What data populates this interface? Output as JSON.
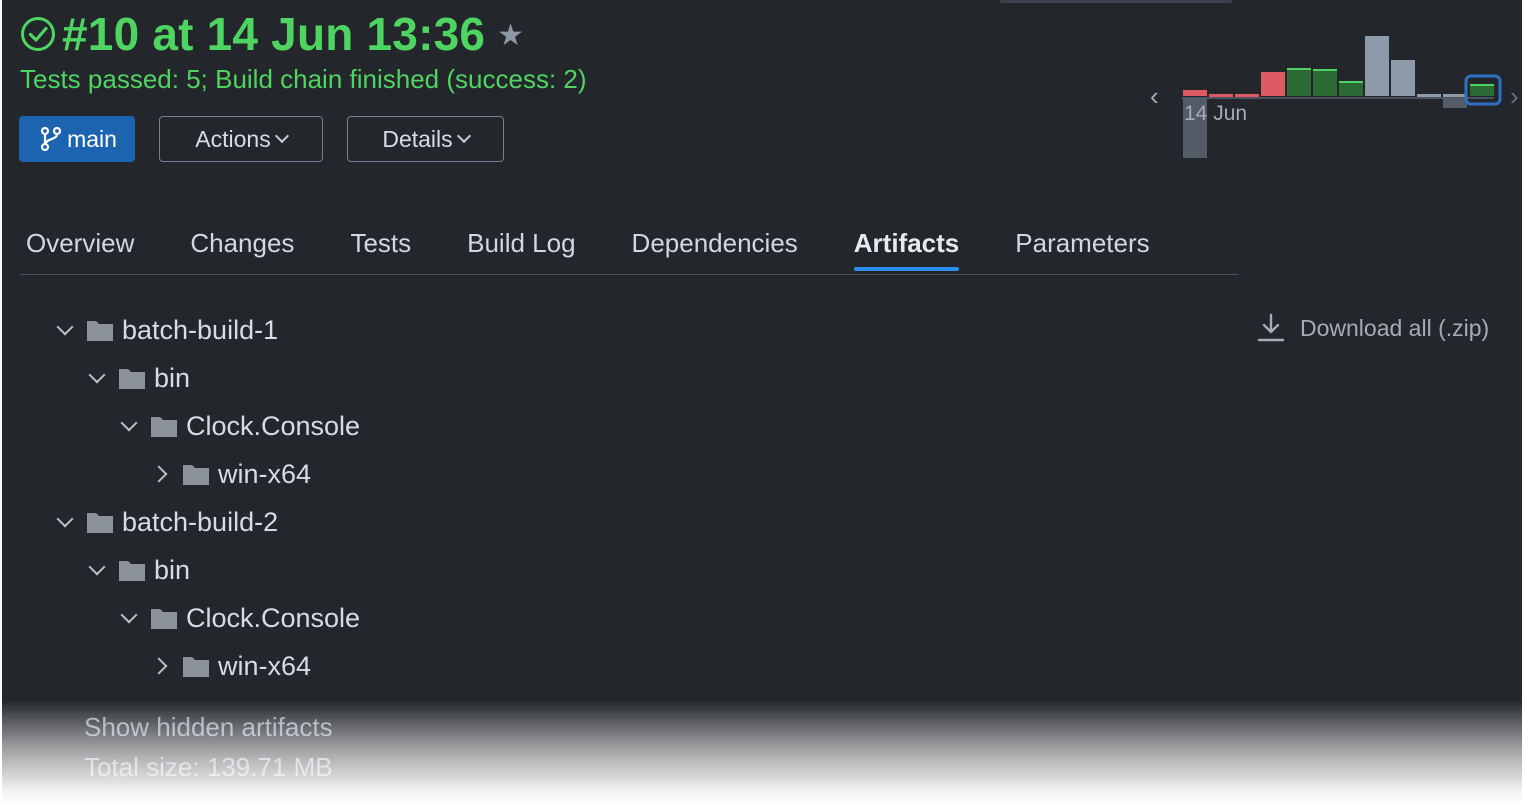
{
  "header": {
    "title": "#10 at 14 Jun 13:36",
    "status_icon": "check-circle-icon",
    "star_icon": "star-icon",
    "subtitle": "Tests passed: 5; Build chain finished (success: 2)",
    "status_color": "#4ed561"
  },
  "buttons": {
    "branch_label": "main",
    "actions_label": "Actions",
    "details_label": "Details"
  },
  "build_chart": {
    "date_label": "14 Jun",
    "prev_icon": "chevron-left-icon",
    "next_icon": "chevron-right-icon"
  },
  "tabs": [
    {
      "label": "Overview",
      "active": false
    },
    {
      "label": "Changes",
      "active": false
    },
    {
      "label": "Tests",
      "active": false
    },
    {
      "label": "Build Log",
      "active": false
    },
    {
      "label": "Dependencies",
      "active": false
    },
    {
      "label": "Artifacts",
      "active": true
    },
    {
      "label": "Parameters",
      "active": false
    }
  ],
  "artifacts": {
    "download_all_label": "Download all (.zip)",
    "tree": [
      {
        "name": "batch-build-1",
        "expanded": true
      },
      {
        "name": "bin",
        "expanded": true
      },
      {
        "name": "Clock.Console",
        "expanded": true
      },
      {
        "name": "win-x64",
        "expanded": false
      },
      {
        "name": "batch-build-2",
        "expanded": true
      },
      {
        "name": "bin",
        "expanded": true
      },
      {
        "name": "Clock.Console",
        "expanded": true
      },
      {
        "name": "win-x64",
        "expanded": false
      }
    ],
    "show_hidden_label": "Show hidden artifacts",
    "total_size_label": "Total size: 139.71 MB"
  },
  "colors": {
    "accent": "#2f8cf0",
    "branch_button": "#1d64b0",
    "failed": "#e05a66",
    "passed": "#2b6a34",
    "neutral": "#8d9aaa"
  }
}
